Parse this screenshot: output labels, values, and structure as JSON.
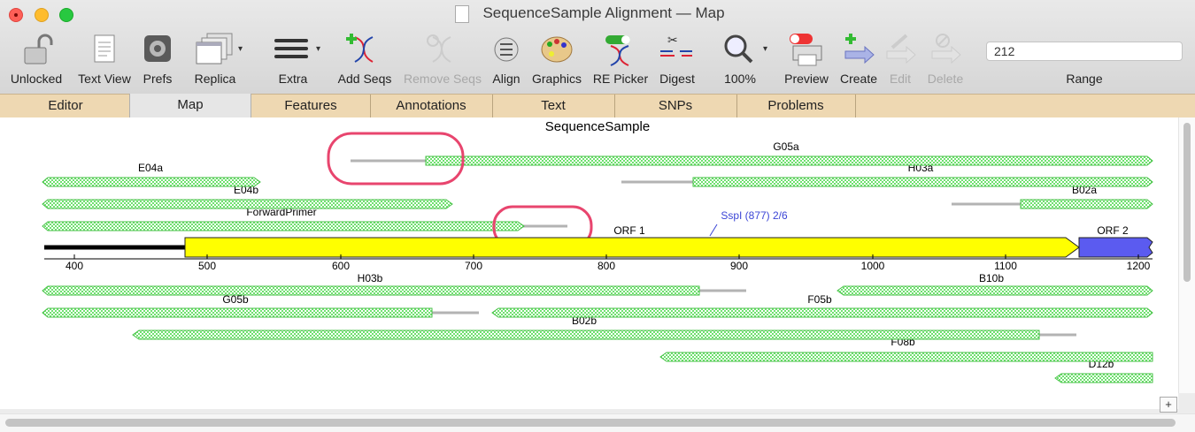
{
  "window": {
    "title": "SequenceSample Alignment — Map"
  },
  "toolbar": {
    "unlocked": "Unlocked",
    "text_view": "Text View",
    "prefs": "Prefs",
    "replica": "Replica",
    "extra": "Extra",
    "add_seqs": "Add Seqs",
    "remove_seqs": "Remove Seqs",
    "align": "Align",
    "graphics": "Graphics",
    "re_picker": "RE Picker",
    "digest": "Digest",
    "zoom": "100%",
    "preview": "Preview",
    "create": "Create",
    "edit": "Edit",
    "delete": "Delete",
    "range_value": "212",
    "range_label": "Range"
  },
  "tabs": [
    "Editor",
    "Map",
    "Features",
    "Annotations",
    "Text",
    "SNPs",
    "Problems"
  ],
  "active_tab": "Map",
  "map": {
    "title": "SequenceSample",
    "axis_ticks": [
      "400",
      "500",
      "600",
      "700",
      "800",
      "900",
      "1000",
      "1100",
      "1200"
    ],
    "features": {
      "orf1": "ORF 1",
      "orf2": "ORF 2",
      "enzyme": "SspI (877) 2/6"
    },
    "reads": {
      "G05a": "G05a",
      "E04a": "E04a",
      "H03a": "H03a",
      "E04b": "E04b",
      "B02a": "B02a",
      "ForwardPrimer": "ForwardPrimer",
      "H03b": "H03b",
      "B10b": "B10b",
      "G05b": "G05b",
      "F05b": "F05b",
      "B02b": "B02b",
      "F08b": "F08b",
      "D12b": "D12b"
    },
    "colors": {
      "read_fill": "#8ee88e",
      "orf1": "#ffff00",
      "orf2": "#5b5bf0",
      "highlight": "#e8456e",
      "enzyme": "#3b45d6"
    }
  },
  "zoom_button": "+"
}
